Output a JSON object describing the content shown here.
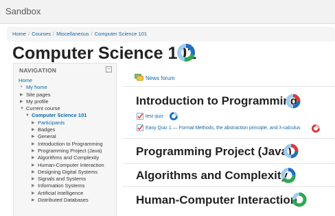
{
  "site": {
    "name": "Sandbox"
  },
  "breadcrumb": [
    "Home",
    "Courses",
    "Miscellaneous",
    "Computer Science 101"
  ],
  "page": {
    "title": "Computer Science 101"
  },
  "navigation": {
    "heading": "NAVIGATION",
    "items": [
      "Home",
      "My home",
      "Site pages",
      "My profile",
      "Current course",
      "Computer Science 101",
      "Participants",
      "Badges",
      "General",
      "Introduction to Programming",
      "Programming Project (Java)",
      "Algorithms and Complexity",
      "Human-Computer Interaction",
      "Designing Digital Systems",
      "Signals and Systems",
      "Information Systems",
      "Artificial Intelligence",
      "Distributed Databases"
    ]
  },
  "main": {
    "news_forum": "News forum",
    "sections": [
      {
        "title": "Introduction to Programming",
        "activities": [
          "test quiz",
          "Easy Quiz 1 — Formal Methods, the abstraction principle, and λ-calculus"
        ]
      },
      {
        "title": "Programming Project (Java)",
        "activities": []
      },
      {
        "title": "Algorithms and Complexity",
        "activities": []
      },
      {
        "title": "Human-Computer Interaction",
        "activities": []
      }
    ]
  },
  "colors": {
    "link": "#0b67a7",
    "ring_blue": "#1f6fc3",
    "ring_red": "#d83a3a",
    "ring_green": "#2fa84f",
    "ring_light": "#9fcbf0"
  }
}
